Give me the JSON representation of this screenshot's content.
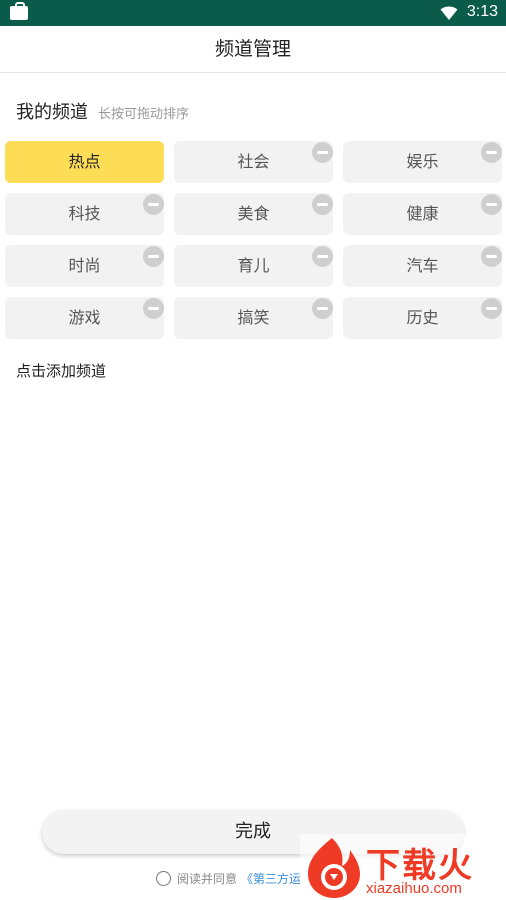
{
  "status_bar": {
    "time": "3:13"
  },
  "header": {
    "title": "频道管理"
  },
  "my_channels": {
    "heading": "我的频道",
    "hint": "长按可拖动排序",
    "items": [
      {
        "label": "热点",
        "active": true
      },
      {
        "label": "社会"
      },
      {
        "label": "娱乐"
      },
      {
        "label": "科技"
      },
      {
        "label": "美食"
      },
      {
        "label": "健康"
      },
      {
        "label": "时尚"
      },
      {
        "label": "育儿"
      },
      {
        "label": "汽车"
      },
      {
        "label": "游戏"
      },
      {
        "label": "搞笑"
      },
      {
        "label": "历史"
      }
    ]
  },
  "add_section": {
    "label": "点击添加频道"
  },
  "footer": {
    "done_label": "完成",
    "agree_text": "阅读并同意",
    "agree_link": "《第三方运"
  },
  "watermark": {
    "brand": "下载火",
    "url": "xiazaihuo.com"
  },
  "colors": {
    "status_bar": "#0b5b4b",
    "active_chip": "#fddd55",
    "chip": "#f2f2f2"
  }
}
